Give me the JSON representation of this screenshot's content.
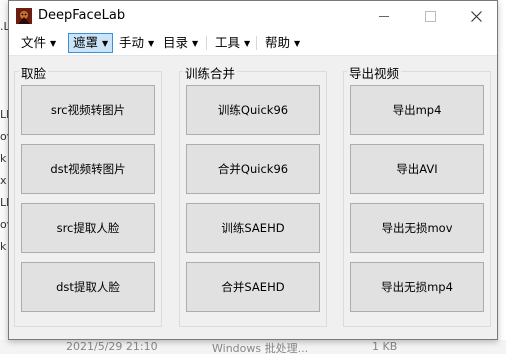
{
  "window": {
    "title": "DeepFaceLab"
  },
  "menu": [
    {
      "label": "文件"
    },
    {
      "label": "遮罩"
    },
    {
      "label": "手动"
    },
    {
      "label": "目录"
    },
    {
      "label": "工具"
    },
    {
      "label": "帮助"
    }
  ],
  "groups": [
    {
      "title": "取脸",
      "buttons": [
        "src视频转图片",
        "dst视频转图片",
        "src提取人脸",
        "dst提取人脸"
      ]
    },
    {
      "title": "训练合并",
      "buttons": [
        "训练Quick96",
        "合并Quick96",
        "训练SAEHD",
        "合并SAEHD"
      ]
    },
    {
      "title": "导出视频",
      "buttons": [
        "导出mp4",
        "导出AVI",
        "导出无损mov",
        "导出无损mp4"
      ]
    }
  ],
  "background": {
    "left_fragments": [
      ".L",
      "Lb",
      "ov",
      "k",
      "x",
      "Lb",
      "ov",
      "k",
      "t"
    ],
    "bottom_date": "2021/5/29 21:10",
    "bottom_type": "Windows 批处理...",
    "bottom_size": "1 KB"
  }
}
